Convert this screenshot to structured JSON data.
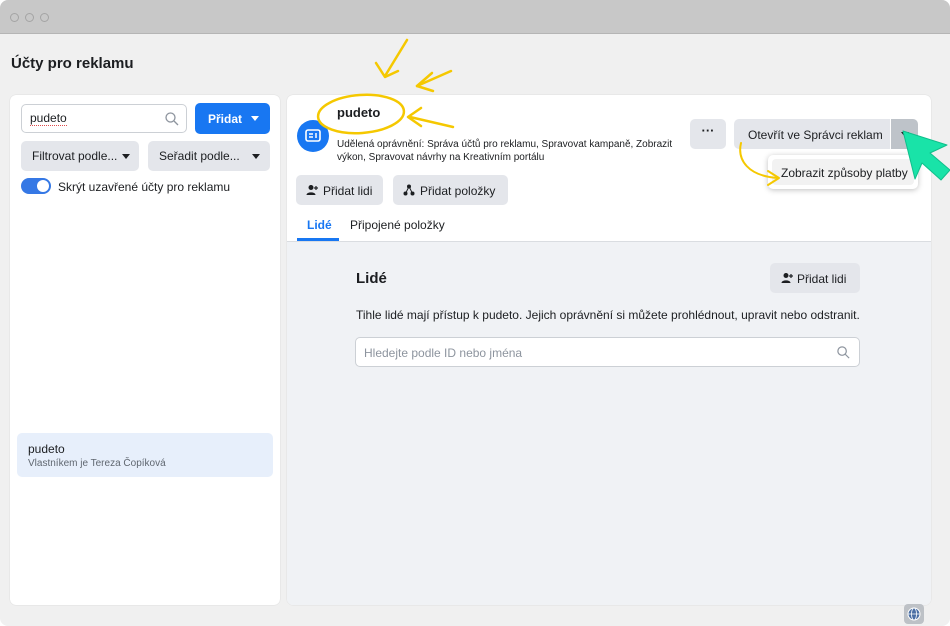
{
  "window": {
    "page_title": "Účty pro reklamu"
  },
  "sidebar": {
    "search_value": "pudeto",
    "add_label": "Přidat",
    "filter_label": "Filtrovat podle...",
    "sort_label": "Seřadit podle...",
    "toggle_label": "Skrýt uzavřené účty pro reklamu",
    "toggle_on": true,
    "account": {
      "name": "pudeto",
      "owner": "Vlastníkem je Tereza Čopíková"
    }
  },
  "account_header": {
    "name": "pudeto",
    "permissions": "Udělená oprávnění: Správa účtů pro reklamu, Spravovat kampaně, Zobrazit výkon, Spravovat návrhy na Kreativním portálu",
    "more_label": "···",
    "open_label": "Otevřít ve Správci reklam",
    "dropdown_item": "Zobrazit způsoby platby",
    "add_people_label": "Přidat lidi",
    "add_items_label": "Přidat položky"
  },
  "tabs": [
    {
      "label": "Lidé",
      "active": true
    },
    {
      "label": "Připojené položky",
      "active": false
    }
  ],
  "people_section": {
    "title": "Lidé",
    "add_label": "Přidat lidi",
    "description": "Tihle lidé mají přístup k pudeto. Jejich oprávnění si můžete prohlédnout, upravit nebo odstranit.",
    "search_placeholder": "Hledejte podle ID nebo jména"
  },
  "colors": {
    "accent": "#1877f2",
    "annotation": "#f5c800",
    "pointer": "#19e3a8"
  },
  "icons": [
    "search-icon",
    "caret-down-icon",
    "ad-account-icon",
    "person-add-icon",
    "items-add-icon",
    "globe-icon",
    "cursor-icon",
    "arrow-annotation"
  ]
}
